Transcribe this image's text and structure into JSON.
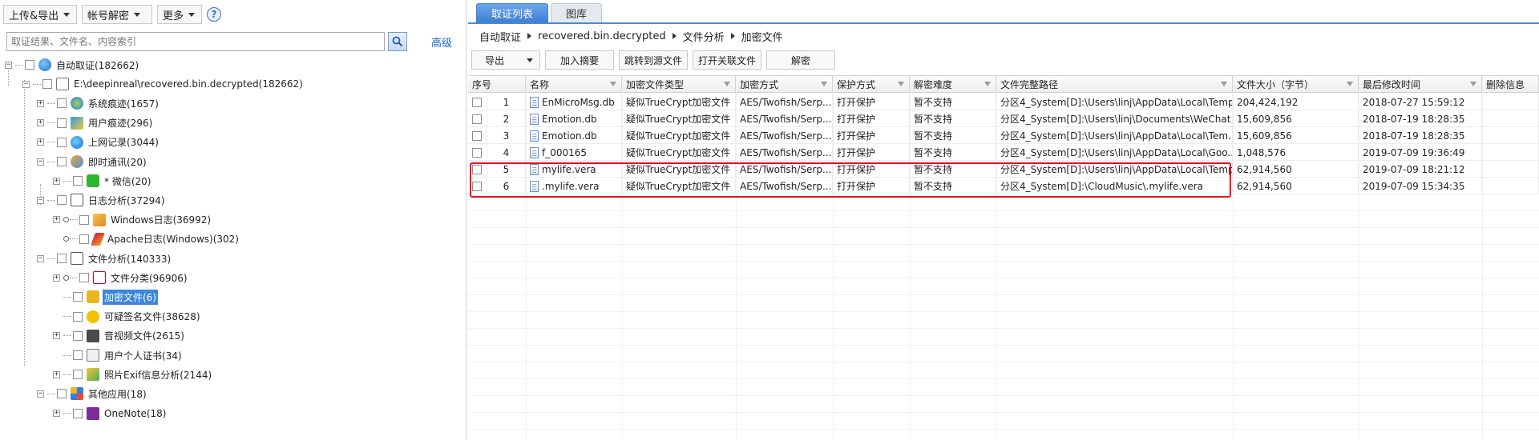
{
  "left_toolbar": {
    "upload_export": "上传&导出",
    "account_decrypt": "帐号解密",
    "more": "更多",
    "help": "?"
  },
  "search": {
    "placeholder": "取证结果、文件名、内容索引",
    "advanced": "高级"
  },
  "tree": [
    {
      "label": "自动取证(182662)",
      "icon": "globe-icon",
      "depth": 0
    },
    {
      "label": "E:\\deepinreal\\recovered.bin.decrypted(182662)",
      "icon": "file-icon",
      "depth": 1
    },
    {
      "label": "系统痕迹(1657)",
      "icon": "system-icon",
      "depth": 2
    },
    {
      "label": "用户痕迹(296)",
      "icon": "user-trace-icon",
      "depth": 2
    },
    {
      "label": "上网记录(3044)",
      "icon": "internet-icon",
      "depth": 2
    },
    {
      "label": "即时通讯(20)",
      "icon": "chat-icon",
      "depth": 2
    },
    {
      "label": "* 微信(20)",
      "icon": "wechat-icon",
      "depth": 3
    },
    {
      "label": "日志分析(37294)",
      "icon": "log-icon",
      "depth": 2
    },
    {
      "label": "Windows日志(36992)",
      "icon": "windows-log-icon",
      "depth": 3
    },
    {
      "label": "Apache日志(Windows)(302)",
      "icon": "apache-feather-icon",
      "depth": 3
    },
    {
      "label": "文件分析(140333)",
      "icon": "file-analysis-icon",
      "depth": 2
    },
    {
      "label": "文件分类(96906)",
      "icon": "file-category-icon",
      "depth": 3
    },
    {
      "label": "加密文件(6)",
      "icon": "lock-icon",
      "depth": 3,
      "selected": true
    },
    {
      "label": "可疑签名文件(38628)",
      "icon": "question-icon",
      "depth": 3
    },
    {
      "label": "音视频文件(2615)",
      "icon": "media-icon",
      "depth": 3
    },
    {
      "label": "用户个人证书(34)",
      "icon": "certificate-icon",
      "depth": 3
    },
    {
      "label": "照片Exif信息分析(2144)",
      "icon": "photo-icon",
      "depth": 3
    },
    {
      "label": "其他应用(18)",
      "icon": "apps-icon",
      "depth": 2
    },
    {
      "label": "OneNote(18)",
      "icon": "onenote-icon",
      "depth": 3
    }
  ],
  "tabs": [
    "取证列表",
    "图库"
  ],
  "breadcrumb": [
    "自动取证",
    "recovered.bin.decrypted",
    "文件分析",
    "加密文件"
  ],
  "actions": {
    "export": "导出",
    "add_summary": "加入摘要",
    "jump_source": "跳转到源文件",
    "open_related": "打开关联文件",
    "decrypt": "解密"
  },
  "columns": [
    "序号",
    "名称",
    "加密文件类型",
    "加密方式",
    "保护方式",
    "解密难度",
    "文件完整路径",
    "文件大小（字节）",
    "最后修改时间",
    "删除信息"
  ],
  "rows": [
    [
      "1",
      "EnMicroMsg.db",
      "疑似TrueCrypt加密文件",
      "AES/Twofish/Serp...",
      "打开保护",
      "暂不支持",
      "分区4_System[D]:\\Users\\linj\\AppData\\Local\\Temp...",
      "204,424,192",
      "2018-07-27 15:59:12",
      ""
    ],
    [
      "2",
      "Emotion.db",
      "疑似TrueCrypt加密文件",
      "AES/Twofish/Serp...",
      "打开保护",
      "暂不支持",
      "分区4_System[D]:\\Users\\linj\\Documents\\WeChat F...",
      "15,609,856",
      "2018-07-19 18:28:35",
      ""
    ],
    [
      "3",
      "Emotion.db",
      "疑似TrueCrypt加密文件",
      "AES/Twofish/Serp...",
      "打开保护",
      "暂不支持",
      "分区4_System[D]:\\Users\\linj\\AppData\\Local\\Tem...",
      "15,609,856",
      "2018-07-19 18:28:35",
      ""
    ],
    [
      "4",
      "f_000165",
      "疑似TrueCrypt加密文件",
      "AES/Twofish/Serp...",
      "打开保护",
      "暂不支持",
      "分区4_System[D]:\\Users\\linj\\AppData\\Local\\Goo...",
      "1,048,576",
      "2019-07-09 19:36:49",
      ""
    ],
    [
      "5",
      "mylife.vera",
      "疑似TrueCrypt加密文件",
      "AES/Twofish/Serp...",
      "打开保护",
      "暂不支持",
      "分区4_System[D]:\\Users\\linj\\AppData\\Local\\Temp...",
      "62,914,560",
      "2019-07-09 18:21:12",
      ""
    ],
    [
      "6",
      ".mylife.vera",
      "疑似TrueCrypt加密文件",
      "AES/Twofish/Serp...",
      "打开保护",
      "暂不支持",
      "分区4_System[D]:\\CloudMusic\\.mylife.vera",
      "62,914,560",
      "2019-07-09 15:34:35",
      ""
    ]
  ],
  "colors": {
    "accent": "#3d86e0",
    "highlight": "#e5101e"
  }
}
